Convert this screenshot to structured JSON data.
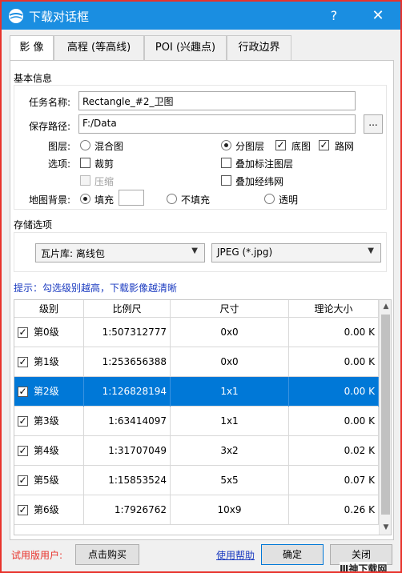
{
  "window": {
    "title": "下载对话框",
    "help": "?",
    "close": "✕",
    "border_color": "#e8332c",
    "titlebar_color": "#1a8ee1"
  },
  "tabs": [
    "影 像",
    "高程 (等高线)",
    "POI (兴趣点)",
    "行政边界"
  ],
  "basic": {
    "section_title": "基本信息",
    "task_label": "任务名称:",
    "task_value": "Rectangle_#2_卫图",
    "save_label": "保存路径:",
    "save_value": "F:/Data",
    "browse": "...",
    "layer_label": "图层:",
    "layer_mixed": "混合图",
    "layer_split": "分图层",
    "layer_base": "底图",
    "layer_road": "路网",
    "option_label": "选项:",
    "opt_crop": "裁剪",
    "opt_label_layer": "叠加标注图层",
    "opt_compress": "压缩",
    "opt_graticule": "叠加经纬网",
    "bg_label": "地图背景:",
    "bg_fill": "填充",
    "bg_nofill": "不填充",
    "bg_transparent": "透明"
  },
  "storage": {
    "section_title": "存储选项",
    "tile_select": "瓦片库: 离线包",
    "format_select": "JPEG (*.jpg)",
    "hint": "提示：勾选级别越高，下载影像越清晰"
  },
  "table": {
    "headers": [
      "级别",
      "比例尺",
      "尺寸",
      "理论大小"
    ],
    "rows": [
      {
        "level": "第0级",
        "scale": "1:507312777",
        "size": "0x0",
        "theory": "0.00 K",
        "checked": true,
        "selected": false
      },
      {
        "level": "第1级",
        "scale": "1:253656388",
        "size": "0x0",
        "theory": "0.00 K",
        "checked": true,
        "selected": false
      },
      {
        "level": "第2级",
        "scale": "1:126828194",
        "size": "1x1",
        "theory": "0.00 K",
        "checked": true,
        "selected": true
      },
      {
        "level": "第3级",
        "scale": "1:63414097",
        "size": "1x1",
        "theory": "0.00 K",
        "checked": true,
        "selected": false
      },
      {
        "level": "第4级",
        "scale": "1:31707049",
        "size": "3x2",
        "theory": "0.02 K",
        "checked": true,
        "selected": false
      },
      {
        "level": "第5级",
        "scale": "1:15853524",
        "size": "5x5",
        "theory": "0.07 K",
        "checked": true,
        "selected": false
      },
      {
        "level": "第6级",
        "scale": "1:7926762",
        "size": "10x9",
        "theory": "0.26 K",
        "checked": true,
        "selected": false
      }
    ]
  },
  "footer": {
    "trial": "试用版用户:",
    "buy": "点击购买",
    "help_link": "使用帮助",
    "ok": "确定",
    "close": "关闭"
  },
  "watermark": "Ⅲ神下载网"
}
